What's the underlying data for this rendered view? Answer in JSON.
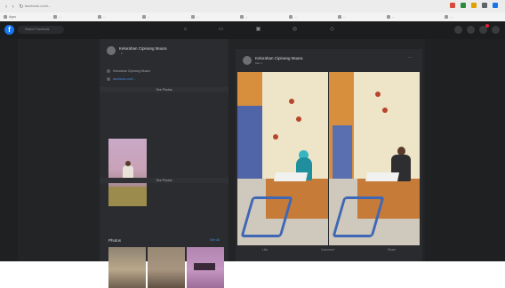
{
  "browser": {
    "back_glyph": "‹ › ↻",
    "url": "facebook.com/...",
    "extension_colors": [
      "#d84b3b",
      "#2b8a3e",
      "#e0a100",
      "#5f6368",
      "#1a73e8"
    ],
    "bookmarks": [
      "Apps",
      "...",
      "...",
      "...",
      "...",
      "...",
      "...",
      "...",
      "...",
      "..."
    ]
  },
  "fb": {
    "logo_letter": "f",
    "search_placeholder": "Search Facebook",
    "nav_icons": [
      "home-icon",
      "watch-icon",
      "marketplace-icon",
      "groups-icon",
      "gaming-icon"
    ]
  },
  "profile": {
    "name": "Kelurahan Cipinang Muara",
    "sub": "· 2",
    "info_lines": [
      "Kelurahan Cipinang Muara",
      "facebook.com/..."
    ],
    "photo_section_label": "See Photos",
    "photos_title": "Photos",
    "see_all": "See All"
  },
  "post": {
    "author": "Kelurahan Cipinang Muara",
    "meta": "Mar 2 ·",
    "actions": [
      "Like",
      "Comment",
      "Share"
    ]
  },
  "colors": {
    "brand": "#1877f2",
    "dark_bg": "#232426",
    "card_bg": "#2a2b2e",
    "link": "#4a88d9"
  }
}
